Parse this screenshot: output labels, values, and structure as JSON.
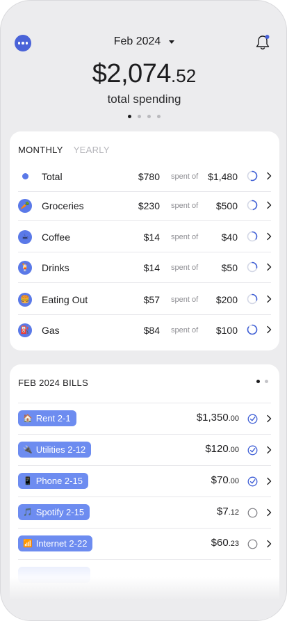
{
  "header": {
    "month": "Feb 2024",
    "total_whole": "$2,074",
    "total_cents": ".52",
    "total_label": "total spending",
    "pager_count": 4,
    "pager_active": 0
  },
  "budget": {
    "tabs": [
      {
        "label": "MONTHLY",
        "active": true
      },
      {
        "label": "YEARLY",
        "active": false
      }
    ],
    "spent_of_label": "spent of",
    "rows": [
      {
        "name": "Total",
        "icon": "dot-icon",
        "spent": "$780",
        "limit": "$1,480",
        "progress": 0.53
      },
      {
        "name": "Groceries",
        "icon": "carrot-icon",
        "spent": "$230",
        "limit": "$500",
        "progress": 0.46
      },
      {
        "name": "Coffee",
        "icon": "coffee-icon",
        "spent": "$14",
        "limit": "$40",
        "progress": 0.35
      },
      {
        "name": "Drinks",
        "icon": "drink-icon",
        "spent": "$14",
        "limit": "$50",
        "progress": 0.28
      },
      {
        "name": "Eating Out",
        "icon": "burger-icon",
        "spent": "$57",
        "limit": "$200",
        "progress": 0.29
      },
      {
        "name": "Gas",
        "icon": "fuel-icon",
        "spent": "$84",
        "limit": "$100",
        "progress": 0.84
      }
    ]
  },
  "bills": {
    "title": "FEB 2024 BILLS",
    "pager_count": 2,
    "pager_active": 0,
    "rows": [
      {
        "label": "Rent 2-1",
        "icon": "house-icon",
        "glyph": "🏠",
        "amount": "$1,350",
        "cents": ".00",
        "paid": true
      },
      {
        "label": "Utilities 2-12",
        "icon": "plug-icon",
        "glyph": "🔌",
        "amount": "$120",
        "cents": ".00",
        "paid": true
      },
      {
        "label": "Phone 2-15",
        "icon": "phone-icon",
        "glyph": "📱",
        "amount": "$70",
        "cents": ".00",
        "paid": true
      },
      {
        "label": "Spotify 2-15",
        "icon": "music-icon",
        "glyph": "🎵",
        "amount": "$7",
        "cents": ".12",
        "paid": false
      },
      {
        "label": "Internet 2-22",
        "icon": "wifi-icon",
        "glyph": "📶",
        "amount": "$60",
        "cents": ".23",
        "paid": false
      }
    ]
  },
  "colors": {
    "accent": "#4a63d8",
    "pill": "#6d8cf0",
    "ring": "#3f5fd6",
    "ring_track": "#d4d8e6"
  }
}
